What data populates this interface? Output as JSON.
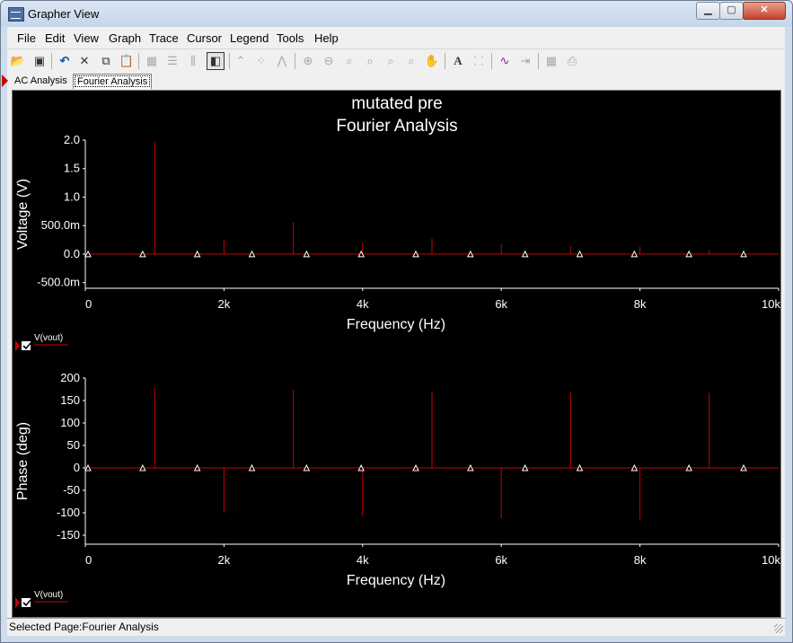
{
  "window": {
    "title": "Grapher View"
  },
  "menu": [
    "File",
    "Edit",
    "View",
    "Graph",
    "Trace",
    "Cursor",
    "Legend",
    "Tools",
    "Help"
  ],
  "tabs": [
    {
      "label": "AC Analysis",
      "selected": false
    },
    {
      "label": "Fourier Analysis",
      "selected": true
    }
  ],
  "status": {
    "text": "Selected Page:Fourier Analysis"
  },
  "graph": {
    "title_line1": "mutated pre",
    "title_line2": "Fourier Analysis",
    "background": "#000000",
    "trace_color": "#cc0000"
  },
  "chart_data": [
    {
      "type": "bar",
      "title": "mutated pre / Fourier Analysis",
      "xlabel": "Frequency (Hz)",
      "ylabel": "Voltage (V)",
      "xlim": [
        0,
        10000
      ],
      "ylim": [
        -0.6,
        2.0
      ],
      "x_ticks": [
        "0",
        "2k",
        "4k",
        "6k",
        "8k",
        "10k"
      ],
      "y_ticks": [
        "2.0",
        "1.5",
        "1.0",
        "500.0m",
        "0.0",
        "-500.0m"
      ],
      "x": [
        1000,
        2000,
        3000,
        4000,
        5000,
        6000,
        7000,
        8000,
        9000
      ],
      "values": [
        1.98,
        0.25,
        0.55,
        0.2,
        0.27,
        0.17,
        0.13,
        0.13,
        0.08
      ],
      "legend": "V(vout)"
    },
    {
      "type": "bar",
      "xlabel": "Frequency (Hz)",
      "ylabel": "Phase (deg)",
      "xlim": [
        0,
        10000
      ],
      "ylim": [
        -170,
        200
      ],
      "x_ticks": [
        "0",
        "2k",
        "4k",
        "6k",
        "8k",
        "10k"
      ],
      "y_ticks": [
        "200",
        "150",
        "100",
        "50",
        "0",
        "-50",
        "-100",
        "-150"
      ],
      "x": [
        1000,
        2000,
        3000,
        4000,
        5000,
        6000,
        7000,
        8000,
        9000
      ],
      "values": [
        178,
        -100,
        175,
        -107,
        170,
        -112,
        168,
        -115,
        167
      ],
      "legend": "V(vout)"
    }
  ]
}
